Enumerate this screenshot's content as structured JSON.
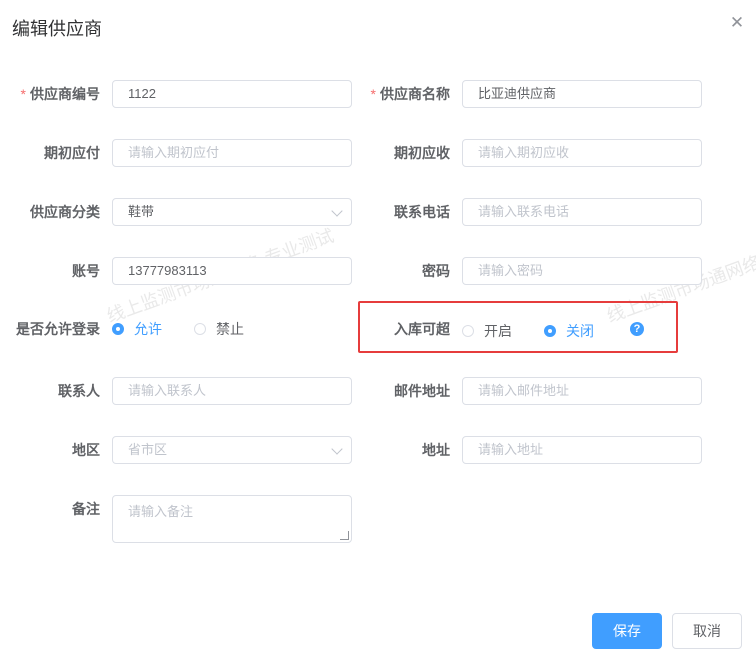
{
  "dialog": {
    "title": "编辑供应商"
  },
  "watermark": {
    "text": "线上监测市场通网络-专业测试"
  },
  "form": {
    "supplier_code": {
      "label": "供应商编号",
      "value": "1122"
    },
    "supplier_name": {
      "label": "供应商名称",
      "value": "比亚迪供应商"
    },
    "opening_payable": {
      "label": "期初应付",
      "placeholder": "请输入期初应付"
    },
    "opening_receivable": {
      "label": "期初应收",
      "placeholder": "请输入期初应收"
    },
    "category": {
      "label": "供应商分类",
      "value": "鞋带"
    },
    "phone": {
      "label": "联系电话",
      "placeholder": "请输入联系电话"
    },
    "account": {
      "label": "账号",
      "value": "13777983113"
    },
    "password": {
      "label": "密码",
      "placeholder": "请输入密码"
    },
    "allow_login": {
      "label": "是否允许登录",
      "options": [
        "允许",
        "禁止"
      ],
      "selected": "允许"
    },
    "overstock": {
      "label": "入库可超",
      "options": [
        "开启",
        "关闭"
      ],
      "selected": "关闭",
      "help": "?"
    },
    "contact": {
      "label": "联系人",
      "placeholder": "请输入联系人"
    },
    "email": {
      "label": "邮件地址",
      "placeholder": "请输入邮件地址"
    },
    "region": {
      "label": "地区",
      "placeholder": "省市区"
    },
    "address": {
      "label": "地址",
      "placeholder": "请输入地址"
    },
    "remark": {
      "label": "备注",
      "placeholder": "请输入备注"
    }
  },
  "buttons": {
    "save": "保存",
    "cancel": "取消"
  },
  "colors": {
    "primary": "#409eff",
    "required": "#f56c6c",
    "highlight": "#e63c3c"
  },
  "icons": {
    "close": "close-icon",
    "select": "chevron-down-icon",
    "help": "question-circle-icon"
  }
}
